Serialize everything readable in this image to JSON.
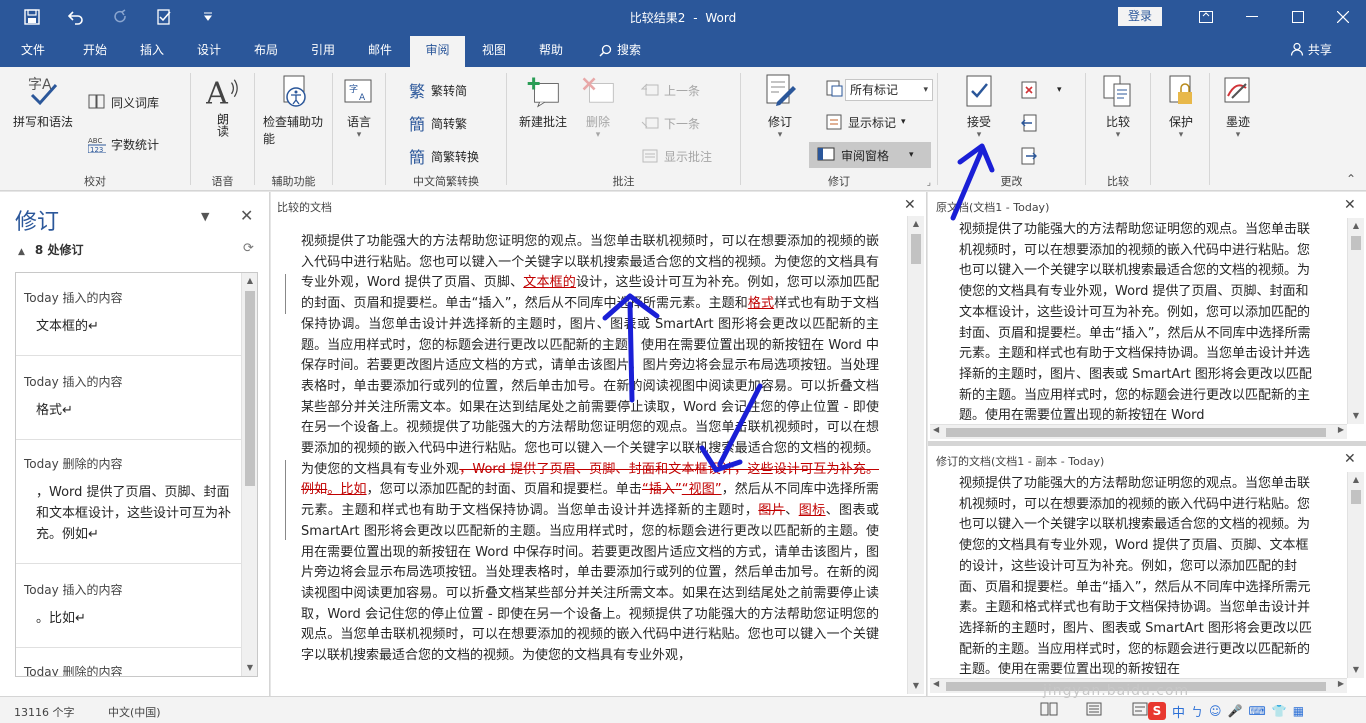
{
  "titlebar": {
    "doc_name": "比较结果2",
    "separator": "-",
    "app_name": "Word",
    "login": "登录"
  },
  "tabs": [
    "文件",
    "开始",
    "插入",
    "设计",
    "布局",
    "引用",
    "邮件",
    "审阅",
    "视图",
    "帮助",
    "搜索"
  ],
  "active_tab": "审阅",
  "share": "共享",
  "ribbon": {
    "spelling": "拼写和语法",
    "thesaurus": "同义词库",
    "wordcount": "字数统计",
    "proofing": "校对",
    "read_aloud": "朗读",
    "speech": "语音",
    "check_access": "检查辅助功能",
    "accessibility": "辅助功能",
    "language": "语言",
    "trad_to_simp": "繁转简",
    "simp_to_trad": "简转繁",
    "convert": "简繁转换",
    "chinese_group": "中文简繁转换",
    "new_comment": "新建批注",
    "delete": "删除",
    "prev": "上一条",
    "next": "下一条",
    "show_comments": "显示批注",
    "comments_group": "批注",
    "track": "修订",
    "markup_select": "所有标记",
    "show_markup": "显示标记",
    "review_pane": "审阅窗格",
    "tracking_group": "修订",
    "accept": "接受",
    "changes_group": "更改",
    "compare": "比较",
    "compare_group": "比较",
    "protect": "保护",
    "ink": "墨迹"
  },
  "revisions": {
    "title": "修订",
    "count": "8 处修订",
    "items": [
      {
        "meta": "Today  插入的内容",
        "body": "文本框的↵"
      },
      {
        "meta": "Today  插入的内容",
        "body": "格式↵"
      },
      {
        "meta": "Today  删除的内容",
        "body": "，Word 提供了页眉、页脚、封面和文本框设计，这些设计可互为补充。例如↵"
      },
      {
        "meta": "Today  插入的内容",
        "body": "。比如↵"
      },
      {
        "meta": "Today  删除的内容",
        "body": ""
      }
    ]
  },
  "compared_doc": {
    "title": "比较的文档",
    "p1": "视频提供了功能强大的方法帮助您证明您的观点。当您单击联机视频时，可以在想要添加的视频的嵌入代码中进行粘贴。您也可以键入一个关键字以联机搜索最适合您的文档的视频。为使您的文档具有专业外观，Word 提供了页眉、页脚、",
    "ins1": "文本框的",
    "p1b": "设计，这些设计可互为补充。例如，您可以添加匹配的封面、页眉和提要栏。单击“插入”，然后从不同库中选择所需元素。主题和",
    "ins2": "格式",
    "p2": "样式也有助于文档保持协调。当您单击设计并选择新的主题时，图片、图表或 SmartArt 图形将会更改以匹配新的主题。当应用样式时，您的标题会进行更改以匹配新的主题。使用在需要位置出现的新按钮在 Word 中保存时间。若要更改图片适应文档的方式，请单击该图片，图片旁边将会显示布局选项按钮。当处理表格时，单击要添加行或列的位置，然后单击加号。在新的阅读视图中阅读更加容易。可以折叠文档某些部分并关注所需文本。如果在达到结尾处之前需要停止读取，Word 会记住您的停止位置 - 即使在另一个设备上。视频提供了功能强大的方法帮助您证明您的观点。当您单击联机视频时，可以在想要添加的视频的嵌入代码中进行粘贴。您也可以键入一个关键字以联机搜索最适合您的文档的视频。为使您的文档具有专业外观",
    "del1": "，Word 提供了页眉、页脚、封面和文本框设计，这些设计可互为补充。例如",
    "ins3": "。比如",
    "p3": "，您可以添加匹配的封面、页眉和提要栏。单击",
    "del2": "“插入”",
    "ins4": "“视图”",
    "p4": "，然后从不同库中选择所需元素。主题和样式也有助于文档保持协调。当您单击设计并选择新的主题时，",
    "del3": "图片",
    "p4b": "、",
    "ins5": "图标",
    "p5": "、图表或 SmartArt 图形将会更改以匹配新的主题。当应用样式时，您的标题会进行更改以匹配新的主题。使用在需要位置出现的新按钮在 Word 中保存时间。若要更改图片适应文档的方式，请单击该图片，图片旁边将会显示布局选项按钮。当处理表格时，单击要添加行或列的位置，然后单击加号。在新的阅读视图中阅读更加容易。可以折叠文档某些部分并关注所需文本。如果在达到结尾处之前需要停止读取，Word 会记住您的停止位置 - 即使在另一个设备上。视频提供了功能强大的方法帮助您证明您的观点。当您单击联机视频时，可以在想要添加的视频的嵌入代码中进行粘贴。您也可以键入一个关键字以联机搜索最适合您的文档的视频。为使您的文档具有专业外观，"
  },
  "original_doc": {
    "title": "原文档(文档1 - Today)",
    "text": "视频提供了功能强大的方法帮助您证明您的观点。当您单击联机视频时，可以在想要添加的视频的嵌入代码中进行粘贴。您也可以键入一个关键字以联机搜索最适合您的文档的视频。为使您的文档具有专业外观，Word 提供了页眉、页脚、封面和文本框设计，这些设计可互为补充。例如，您可以添加匹配的封面、页眉和提要栏。单击“插入”，然后从不同库中选择所需元素。主题和样式也有助于文档保持协调。当您单击设计并选择新的主题时，图片、图表或 SmartArt 图形将会更改以匹配新的主题。当应用样式时，您的标题会进行更改以匹配新的主题。使用在需要位置出现的新按钮在 Word"
  },
  "revised_doc": {
    "title": "修订的文档(文档1 - 副本 - Today)",
    "text": "视频提供了功能强大的方法帮助您证明您的观点。当您单击联机视频时，可以在想要添加的视频的嵌入代码中进行粘贴。您也可以键入一个关键字以联机搜索最适合您的文档的视频。为使您的文档具有专业外观，Word 提供了页眉、页脚、文本框的设计，这些设计可互为补充。例如，您可以添加匹配的封面、页眉和提要栏。单击“插入”，然后从不同库中选择所需元素。主题和格式样式也有助于文档保持协调。当您单击设计并选择新的主题时，图片、图表或 SmartArt 图形将会更改以匹配新的主题。当应用样式时，您的标题会进行更改以匹配新的主题。使用在需要位置出现的新按钮在"
  },
  "status": {
    "words": "13116 个字",
    "language": "中文(中国)",
    "ime": "中",
    "ime_symbol": "ㄅ"
  },
  "watermark": "jingyan.baidu.com",
  "colors": {
    "brand": "#2b579a",
    "revision": "#c00000",
    "annotation_arrow": "#1a1fd6"
  }
}
